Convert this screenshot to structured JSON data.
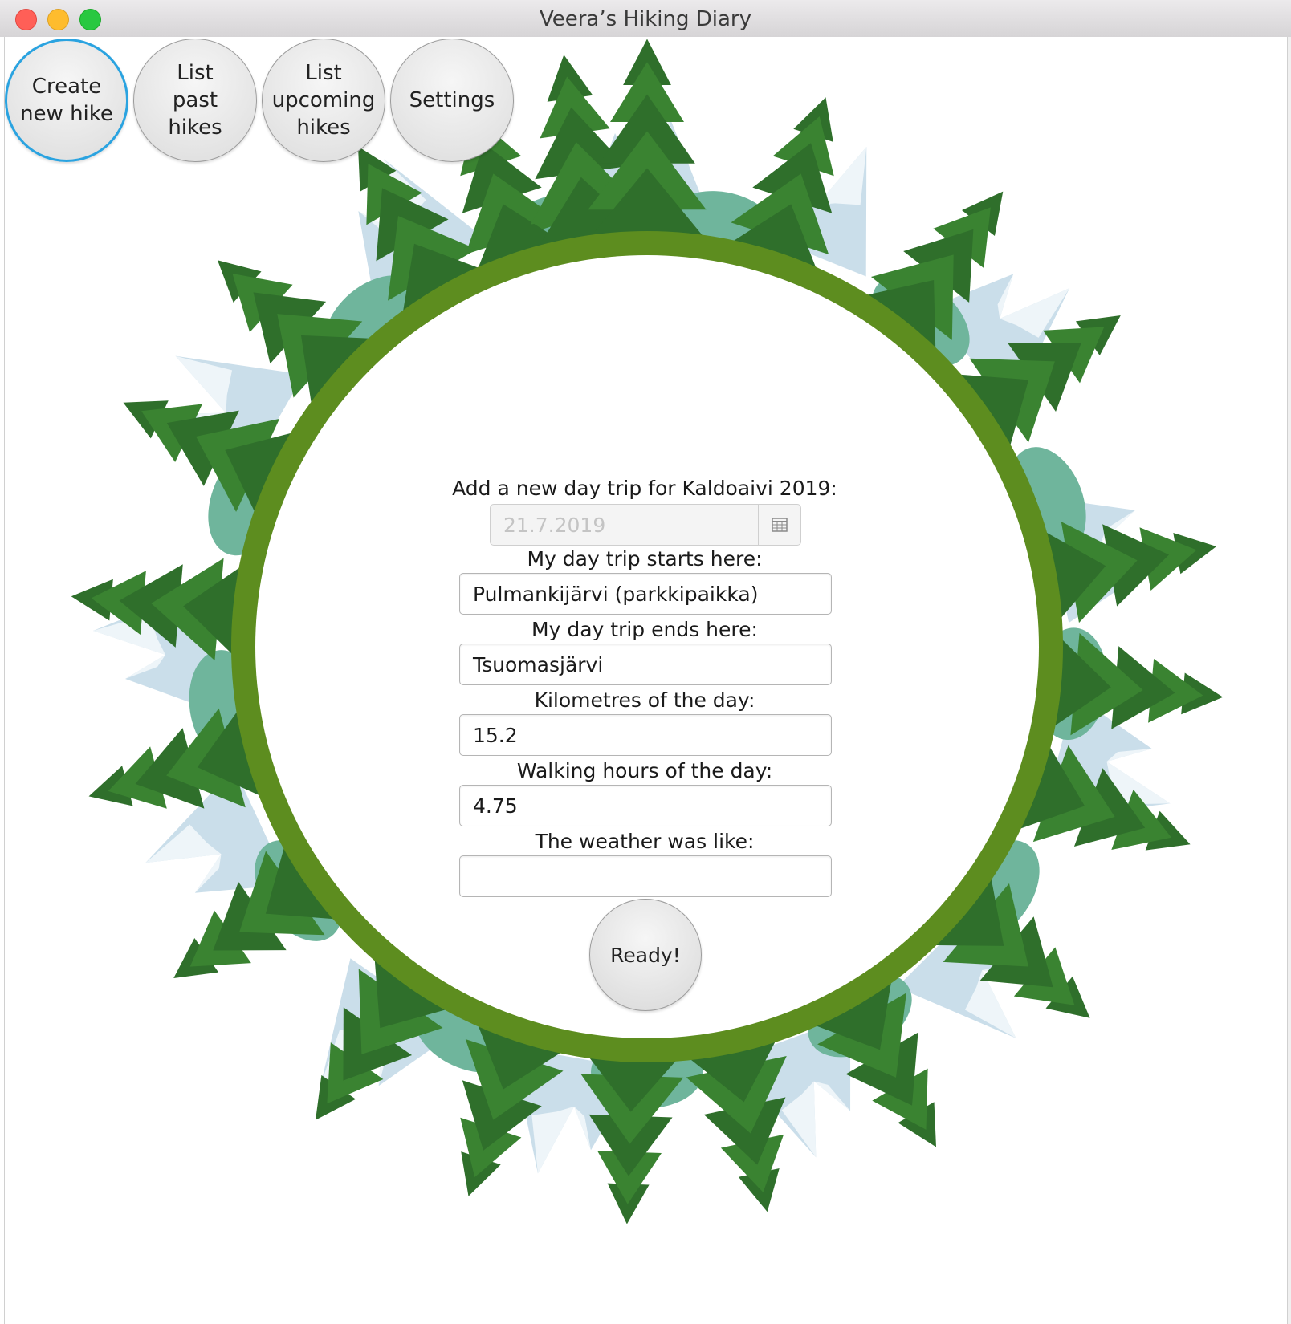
{
  "window": {
    "title": "Veera’s Hiking Diary"
  },
  "nav": {
    "create": "Create\nnew hike",
    "past": "List\npast\nhikes",
    "upcoming": "List\nupcoming\nhikes",
    "settings": "Settings"
  },
  "form": {
    "heading": "Add a new day trip for Kaldoaivi 2019:",
    "date_value": "21.7.2019",
    "start_label": "My day trip starts here:",
    "start_value": "Pulmankijärvi (parkkipaikka)",
    "end_label": "My day trip ends here:",
    "end_value": "Tsuomasjärvi",
    "km_label": "Kilometres of the day:",
    "km_value": "15.2",
    "hours_label": "Walking hours of the day:",
    "hours_value": "4.75",
    "weather_label": "The weather was like:",
    "weather_value": "",
    "ready": "Ready!"
  },
  "icons": {
    "calendar": "calendar-icon"
  },
  "colors": {
    "ring": "#5d8d1f",
    "tree_dark": "#2e6b2a",
    "tree_mid": "#3f8a33",
    "mountain": "#c9dde8",
    "focus": "#2aa3e0"
  }
}
